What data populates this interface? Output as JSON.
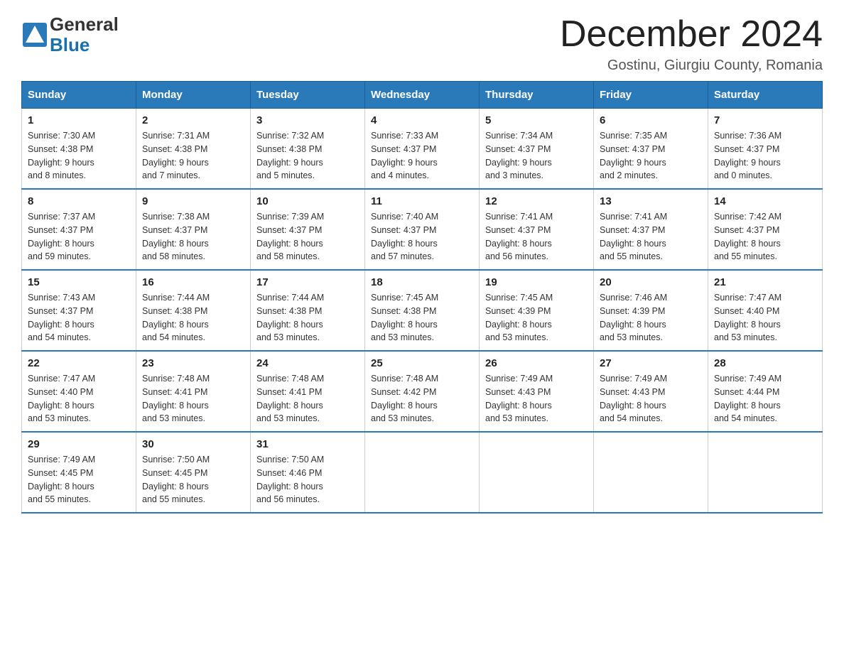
{
  "header": {
    "logo_general": "General",
    "logo_blue": "Blue",
    "month_title": "December 2024",
    "location": "Gostinu, Giurgiu County, Romania"
  },
  "days_of_week": [
    "Sunday",
    "Monday",
    "Tuesday",
    "Wednesday",
    "Thursday",
    "Friday",
    "Saturday"
  ],
  "weeks": [
    [
      {
        "day": "1",
        "sunrise": "7:30 AM",
        "sunset": "4:38 PM",
        "daylight": "9 hours and 8 minutes."
      },
      {
        "day": "2",
        "sunrise": "7:31 AM",
        "sunset": "4:38 PM",
        "daylight": "9 hours and 7 minutes."
      },
      {
        "day": "3",
        "sunrise": "7:32 AM",
        "sunset": "4:38 PM",
        "daylight": "9 hours and 5 minutes."
      },
      {
        "day": "4",
        "sunrise": "7:33 AM",
        "sunset": "4:37 PM",
        "daylight": "9 hours and 4 minutes."
      },
      {
        "day": "5",
        "sunrise": "7:34 AM",
        "sunset": "4:37 PM",
        "daylight": "9 hours and 3 minutes."
      },
      {
        "day": "6",
        "sunrise": "7:35 AM",
        "sunset": "4:37 PM",
        "daylight": "9 hours and 2 minutes."
      },
      {
        "day": "7",
        "sunrise": "7:36 AM",
        "sunset": "4:37 PM",
        "daylight": "9 hours and 0 minutes."
      }
    ],
    [
      {
        "day": "8",
        "sunrise": "7:37 AM",
        "sunset": "4:37 PM",
        "daylight": "8 hours and 59 minutes."
      },
      {
        "day": "9",
        "sunrise": "7:38 AM",
        "sunset": "4:37 PM",
        "daylight": "8 hours and 58 minutes."
      },
      {
        "day": "10",
        "sunrise": "7:39 AM",
        "sunset": "4:37 PM",
        "daylight": "8 hours and 58 minutes."
      },
      {
        "day": "11",
        "sunrise": "7:40 AM",
        "sunset": "4:37 PM",
        "daylight": "8 hours and 57 minutes."
      },
      {
        "day": "12",
        "sunrise": "7:41 AM",
        "sunset": "4:37 PM",
        "daylight": "8 hours and 56 minutes."
      },
      {
        "day": "13",
        "sunrise": "7:41 AM",
        "sunset": "4:37 PM",
        "daylight": "8 hours and 55 minutes."
      },
      {
        "day": "14",
        "sunrise": "7:42 AM",
        "sunset": "4:37 PM",
        "daylight": "8 hours and 55 minutes."
      }
    ],
    [
      {
        "day": "15",
        "sunrise": "7:43 AM",
        "sunset": "4:37 PM",
        "daylight": "8 hours and 54 minutes."
      },
      {
        "day": "16",
        "sunrise": "7:44 AM",
        "sunset": "4:38 PM",
        "daylight": "8 hours and 54 minutes."
      },
      {
        "day": "17",
        "sunrise": "7:44 AM",
        "sunset": "4:38 PM",
        "daylight": "8 hours and 53 minutes."
      },
      {
        "day": "18",
        "sunrise": "7:45 AM",
        "sunset": "4:38 PM",
        "daylight": "8 hours and 53 minutes."
      },
      {
        "day": "19",
        "sunrise": "7:45 AM",
        "sunset": "4:39 PM",
        "daylight": "8 hours and 53 minutes."
      },
      {
        "day": "20",
        "sunrise": "7:46 AM",
        "sunset": "4:39 PM",
        "daylight": "8 hours and 53 minutes."
      },
      {
        "day": "21",
        "sunrise": "7:47 AM",
        "sunset": "4:40 PM",
        "daylight": "8 hours and 53 minutes."
      }
    ],
    [
      {
        "day": "22",
        "sunrise": "7:47 AM",
        "sunset": "4:40 PM",
        "daylight": "8 hours and 53 minutes."
      },
      {
        "day": "23",
        "sunrise": "7:48 AM",
        "sunset": "4:41 PM",
        "daylight": "8 hours and 53 minutes."
      },
      {
        "day": "24",
        "sunrise": "7:48 AM",
        "sunset": "4:41 PM",
        "daylight": "8 hours and 53 minutes."
      },
      {
        "day": "25",
        "sunrise": "7:48 AM",
        "sunset": "4:42 PM",
        "daylight": "8 hours and 53 minutes."
      },
      {
        "day": "26",
        "sunrise": "7:49 AM",
        "sunset": "4:43 PM",
        "daylight": "8 hours and 53 minutes."
      },
      {
        "day": "27",
        "sunrise": "7:49 AM",
        "sunset": "4:43 PM",
        "daylight": "8 hours and 54 minutes."
      },
      {
        "day": "28",
        "sunrise": "7:49 AM",
        "sunset": "4:44 PM",
        "daylight": "8 hours and 54 minutes."
      }
    ],
    [
      {
        "day": "29",
        "sunrise": "7:49 AM",
        "sunset": "4:45 PM",
        "daylight": "8 hours and 55 minutes."
      },
      {
        "day": "30",
        "sunrise": "7:50 AM",
        "sunset": "4:45 PM",
        "daylight": "8 hours and 55 minutes."
      },
      {
        "day": "31",
        "sunrise": "7:50 AM",
        "sunset": "4:46 PM",
        "daylight": "8 hours and 56 minutes."
      },
      null,
      null,
      null,
      null
    ]
  ],
  "labels": {
    "sunrise": "Sunrise:",
    "sunset": "Sunset:",
    "daylight": "Daylight:"
  }
}
